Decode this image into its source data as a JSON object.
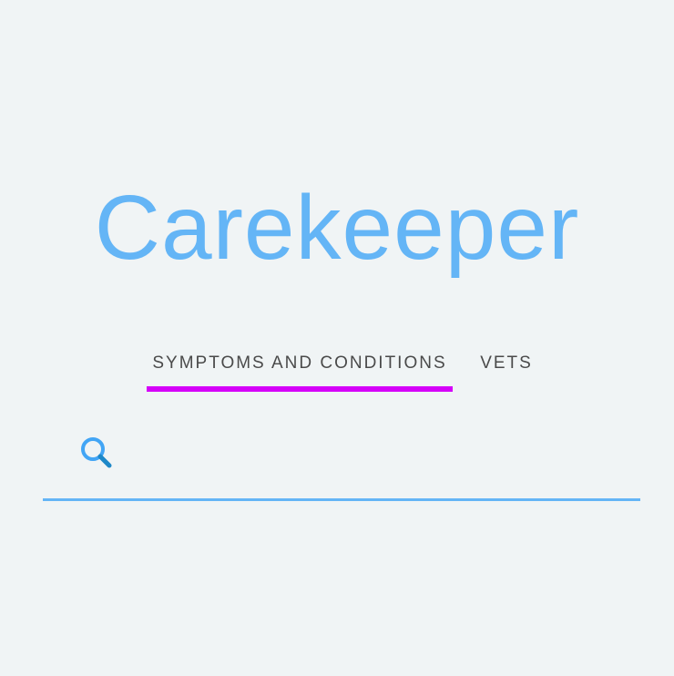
{
  "app": {
    "title": "Carekeeper"
  },
  "tabs": [
    {
      "label": "SYMPTOMS AND CONDITIONS",
      "active": true
    },
    {
      "label": "VETS",
      "active": false
    }
  ],
  "search": {
    "value": "",
    "placeholder": "",
    "icon": "search-icon"
  },
  "colors": {
    "background": "#f0f4f5",
    "title": "#64b5f6",
    "tab_indicator": "#d500f9",
    "tab_text": "#4a4a4a",
    "search_underline": "#64b5f6",
    "search_icon": "#42a5f5"
  }
}
